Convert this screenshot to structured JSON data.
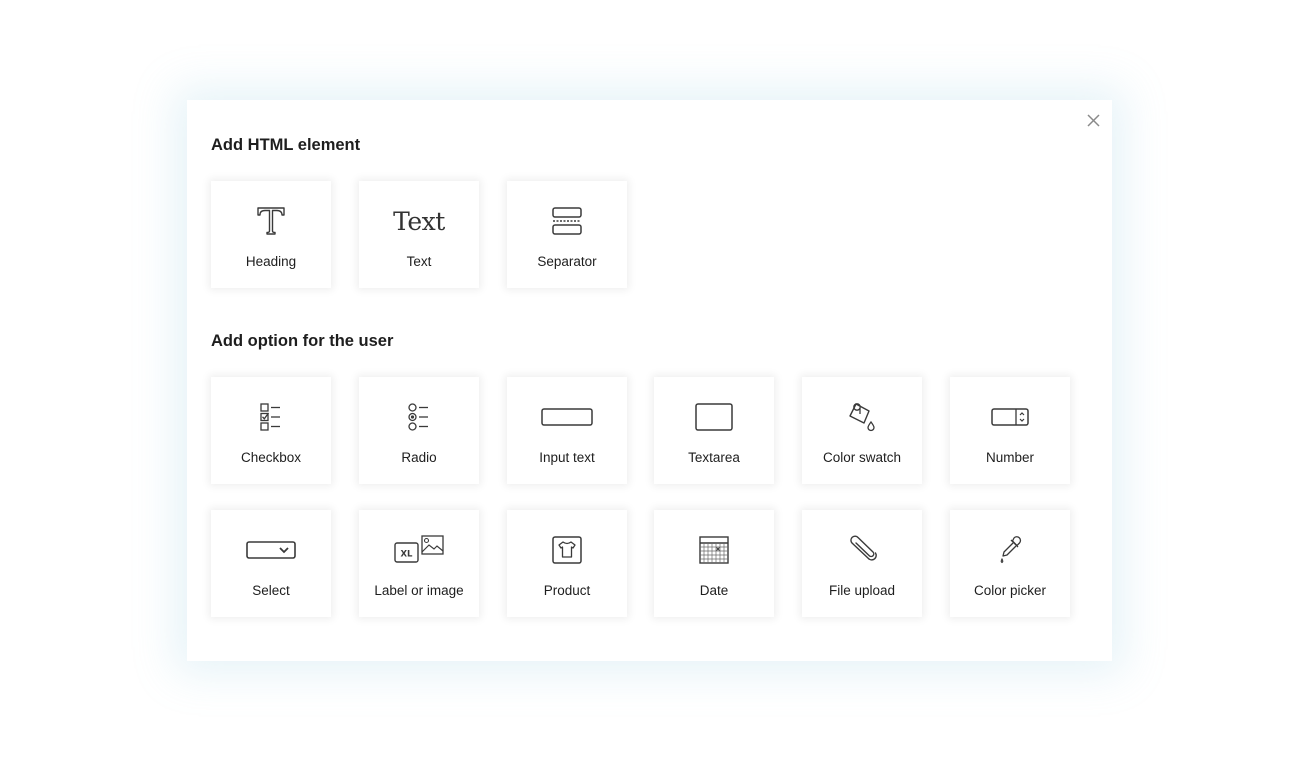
{
  "dialog": {
    "close_icon": "close-icon"
  },
  "sections": {
    "html_elements": {
      "title": "Add HTML element",
      "items": [
        {
          "label": "Heading",
          "icon": "heading-icon"
        },
        {
          "label": "Text",
          "icon": "text-icon",
          "glyph": "Text"
        },
        {
          "label": "Separator",
          "icon": "separator-icon"
        }
      ]
    },
    "user_options": {
      "title": "Add option for the user",
      "items": [
        {
          "label": "Checkbox",
          "icon": "checkbox-icon"
        },
        {
          "label": "Radio",
          "icon": "radio-icon"
        },
        {
          "label": "Input text",
          "icon": "input-text-icon"
        },
        {
          "label": "Textarea",
          "icon": "textarea-icon"
        },
        {
          "label": "Color swatch",
          "icon": "paint-bucket-icon"
        },
        {
          "label": "Number",
          "icon": "number-stepper-icon"
        },
        {
          "label": "Select",
          "icon": "select-dropdown-icon"
        },
        {
          "label": "Label or image",
          "icon": "label-image-icon",
          "glyph": "XL"
        },
        {
          "label": "Product",
          "icon": "tshirt-icon"
        },
        {
          "label": "Date",
          "icon": "calendar-icon"
        },
        {
          "label": "File upload",
          "icon": "paperclip-icon"
        },
        {
          "label": "Color picker",
          "icon": "eyedropper-icon"
        }
      ]
    }
  }
}
